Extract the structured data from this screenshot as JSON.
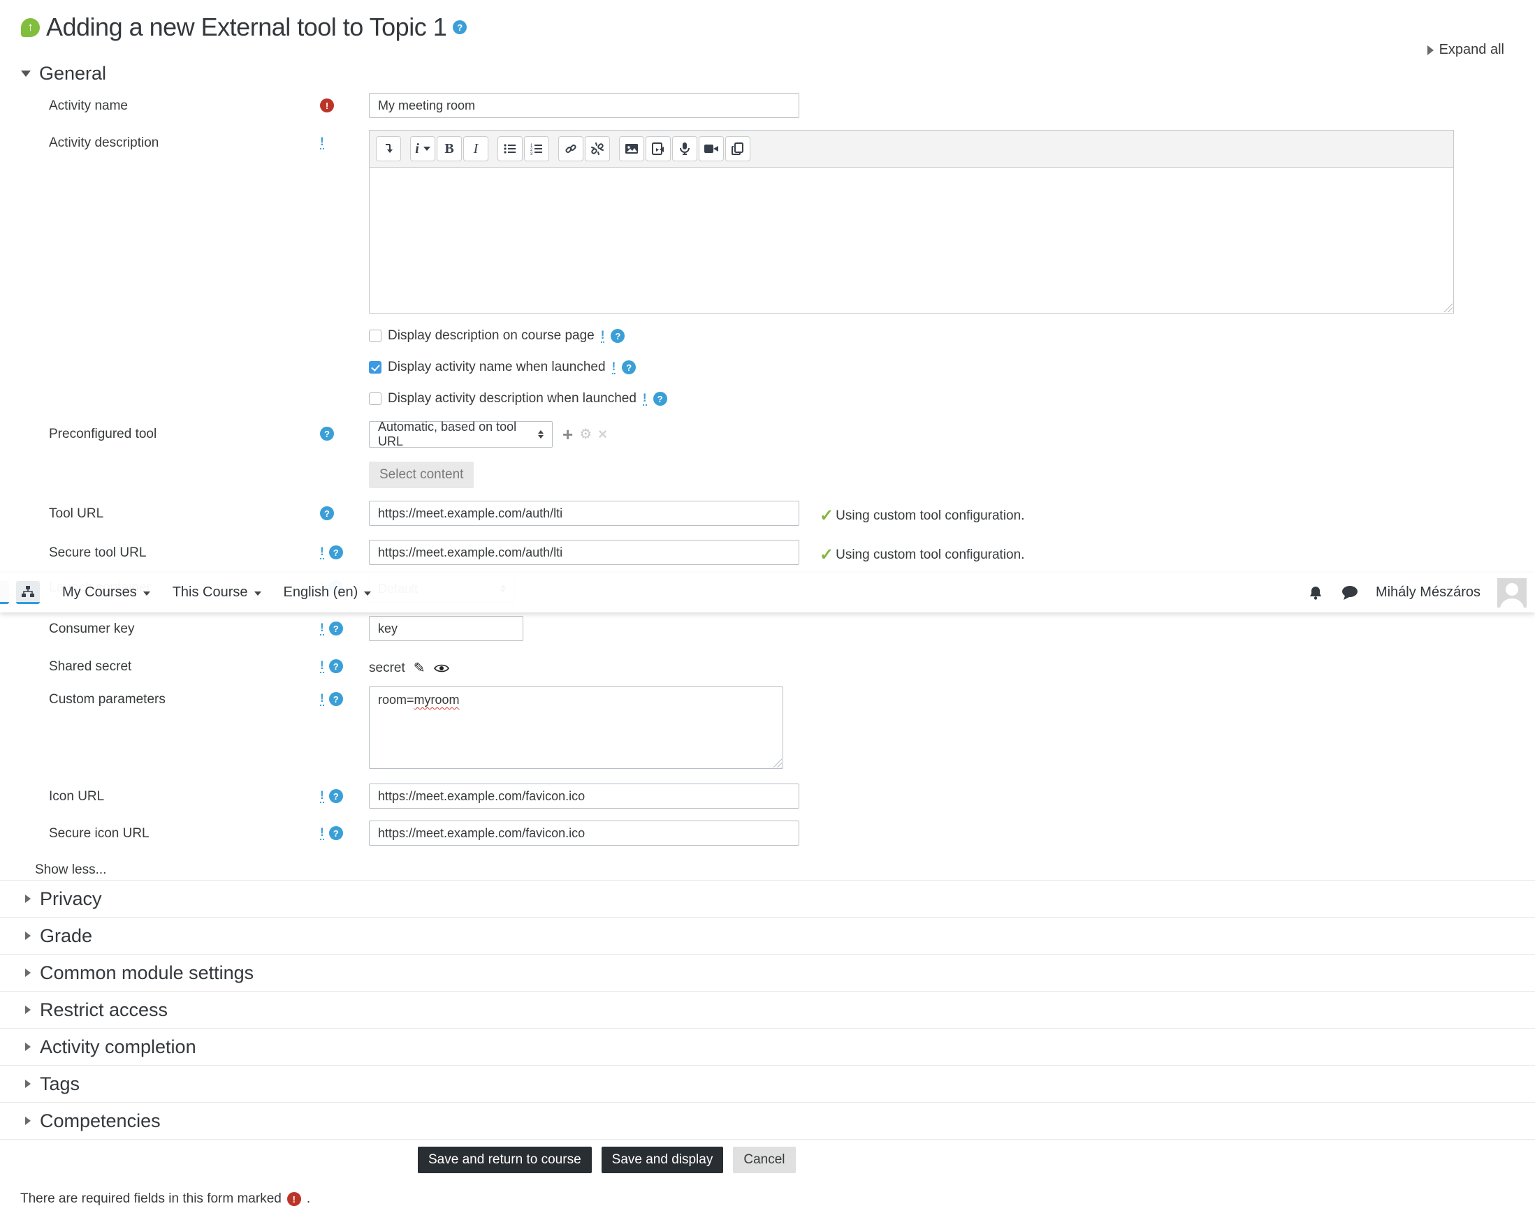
{
  "header": {
    "title": "Adding a new External tool to Topic 1",
    "expand_all": "Expand all"
  },
  "navbar": {
    "items": {
      "my_courses": "My Courses",
      "this_course": "This Course",
      "language": "English (en)"
    },
    "user_name": "Mihály Mészáros"
  },
  "general": {
    "heading": "General"
  },
  "fields": {
    "activity_name": {
      "label": "Activity name",
      "value": "My meeting room"
    },
    "activity_description": {
      "label": "Activity description"
    },
    "checkboxes": {
      "display_description": {
        "label": "Display description on course page",
        "checked": false
      },
      "display_activity_name": {
        "label": "Display activity name when launched",
        "checked": true
      },
      "display_activity_description": {
        "label": "Display activity description when launched",
        "checked": false
      }
    },
    "preconfigured_tool": {
      "label": "Preconfigured tool",
      "value": "Automatic, based on tool URL",
      "select_content": "Select content"
    },
    "tool_url": {
      "label": "Tool URL",
      "value": "https://meet.example.com/auth/lti",
      "status": "Using custom tool configuration."
    },
    "secure_tool_url": {
      "label": "Secure tool URL",
      "value": "https://meet.example.com/auth/lti",
      "status": "Using custom tool configuration."
    },
    "launch_container": {
      "label": "Launch container",
      "value": "Default"
    },
    "consumer_key": {
      "label": "Consumer key",
      "value": "key"
    },
    "shared_secret": {
      "label": "Shared secret",
      "value": "secret"
    },
    "custom_parameters": {
      "label": "Custom parameters",
      "value_prefix": "room=",
      "value_misspelled": "myroom"
    },
    "icon_url": {
      "label": "Icon URL",
      "value": "https://meet.example.com/favicon.ico"
    },
    "secure_icon_url": {
      "label": "Secure icon URL",
      "value": "https://meet.example.com/favicon.ico"
    },
    "show_less": "Show less..."
  },
  "sections": {
    "privacy": "Privacy",
    "grade": "Grade",
    "common_module": "Common module settings",
    "restrict_access": "Restrict access",
    "activity_completion": "Activity completion",
    "tags": "Tags",
    "competencies": "Competencies"
  },
  "buttons": {
    "save_return": "Save and return to course",
    "save_display": "Save and display",
    "cancel": "Cancel"
  },
  "footer": {
    "required_prefix": "There are required fields in this form marked",
    "required_suffix": "."
  },
  "editor_labels": {
    "bold": "B",
    "italic": "I",
    "style": "i"
  },
  "icons": {
    "question": "?",
    "exclamation": "!",
    "check": "✓",
    "pencil": "✎",
    "plus": "+",
    "gear": "⚙",
    "close": "×",
    "up_arrow": "↑"
  },
  "colors": {
    "help_blue": "#3a9fd6",
    "required_red": "#bc3428",
    "check_green": "#84b642",
    "tool_green": "#82be3e",
    "checkbox_blue": "#3e99e5",
    "nav_active_blue": "#2e9ce4",
    "button_dark": "#292e33"
  }
}
